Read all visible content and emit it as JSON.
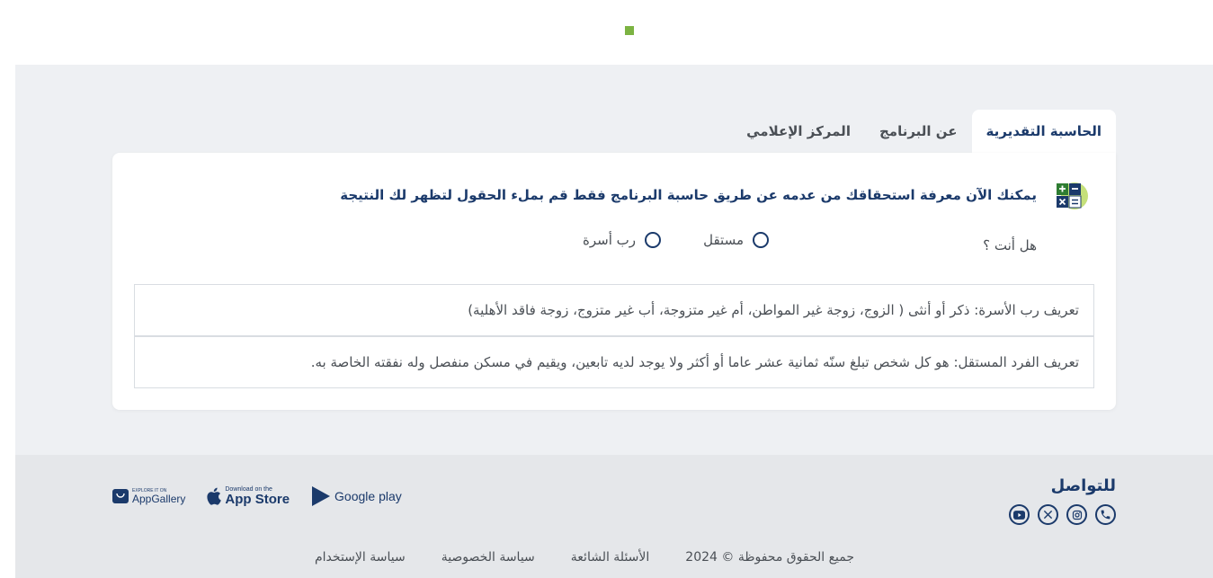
{
  "tabs": [
    {
      "label": "الحاسبة التقديرية",
      "active": true
    },
    {
      "label": "عن البرنامج",
      "active": false
    },
    {
      "label": "المركز الإعلامي",
      "active": false
    }
  ],
  "calculator": {
    "intro": "يمكنك الآن معرفة استحقاقك من عدمه عن طريق حاسبة البرنامج فقط قم بملء الحقول لتظهر لك النتيجة",
    "question": "هل أنت ؟",
    "options": [
      "مستقل",
      "رب أسرة"
    ],
    "definitions": [
      "تعريف رب الأسرة: ذكر أو أنثى ( الزوج، زوجة غير المواطن، أم غير متزوجة، أب غير متزوج، زوجة فاقد الأهلية)",
      "تعريف الفرد المستقل: هو كل شخص تبلغ سنّه ثمانية عشر عاما أو أكثر ولا يوجد لديه تابعين، ويقيم في مسكن منفصل وله نفقته الخاصة به."
    ]
  },
  "footer": {
    "contact_title": "للتواصل",
    "social_icons": [
      "phone-icon",
      "instagram-icon",
      "x-icon",
      "youtube-icon"
    ],
    "stores": {
      "google_play": "Google play",
      "app_store_small": "Download on the",
      "app_store": "App Store",
      "app_gallery_small": "EXPLORE IT ON",
      "app_gallery": "AppGallery"
    },
    "links": [
      "جميع الحقوق محفوظة © 2024",
      "الأسئلة الشائعة",
      "سياسة الخصوصية",
      "سياسة الإستخدام"
    ]
  },
  "colors": {
    "primary": "#1b3a6b",
    "accent": "#7cb342",
    "background": "#eef0f3"
  }
}
